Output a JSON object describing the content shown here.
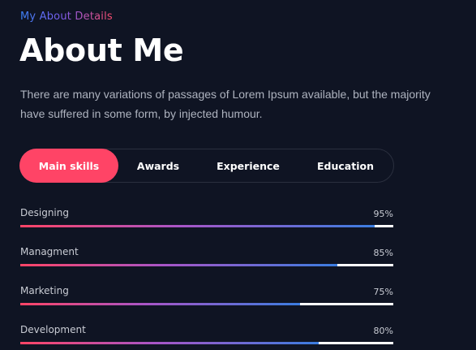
{
  "header": {
    "eyebrow": "My About Details",
    "title": "About Me",
    "description": "There are many variations of passages of Lorem Ipsum available, but the majority have suffered in some form, by injected humour."
  },
  "tabs": [
    {
      "label": "Main skills",
      "active": true
    },
    {
      "label": "Awards",
      "active": false
    },
    {
      "label": "Experience",
      "active": false
    },
    {
      "label": "Education",
      "active": false
    }
  ],
  "skills": [
    {
      "name": "Designing",
      "percent_label": "95%",
      "value": 95
    },
    {
      "name": "Managment",
      "percent_label": "85%",
      "value": 85
    },
    {
      "name": "Marketing",
      "percent_label": "75%",
      "value": 75
    },
    {
      "name": "Development",
      "percent_label": "80%",
      "value": 80
    }
  ],
  "colors": {
    "background": "#0f1423",
    "accent": "#ff4466",
    "gradient_end": "#3b7de0"
  }
}
